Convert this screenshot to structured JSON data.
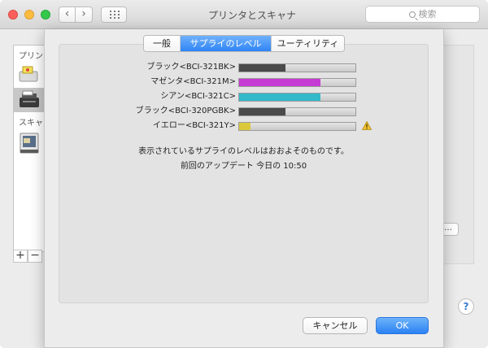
{
  "window": {
    "title": "プリンタとスキャナ",
    "search_placeholder": "検索",
    "back_glyph": "‹",
    "forward_glyph": "›"
  },
  "sidebar": {
    "printers_header": "プリン",
    "scanners_header": "スキャ",
    "add_label": "+",
    "remove_label": "−",
    "icons": [
      "printer-icon",
      "printer-icon",
      "scanner-icon"
    ]
  },
  "options_button_label": "…",
  "help_label": "?",
  "sheet": {
    "tabs": [
      {
        "label": "一般",
        "active": false
      },
      {
        "label": "サプライのレベル",
        "active": true
      },
      {
        "label": "ユーティリティ",
        "active": false
      }
    ],
    "supplies": [
      {
        "label": "ブラック<BCI-321BK>",
        "level": 0.4,
        "color": "#4a4a4a",
        "warning": false
      },
      {
        "label": "マゼンタ<BCI-321M>",
        "level": 0.7,
        "color": "#c63bd4",
        "warning": false
      },
      {
        "label": "シアン<BCI-321C>",
        "level": 0.7,
        "color": "#33b9c9",
        "warning": false
      },
      {
        "label": "ブラック<BCI-320PGBK>",
        "level": 0.4,
        "color": "#4a4a4a",
        "warning": false
      },
      {
        "label": "イエロー<BCI-321Y>",
        "level": 0.1,
        "color": "#dcc93a",
        "warning": true
      }
    ],
    "note": "表示されているサプライのレベルはおおよそのものです。",
    "last_updated": "前回のアップデート 今日の 10:50",
    "cancel_label": "キャンセル",
    "ok_label": "OK"
  }
}
